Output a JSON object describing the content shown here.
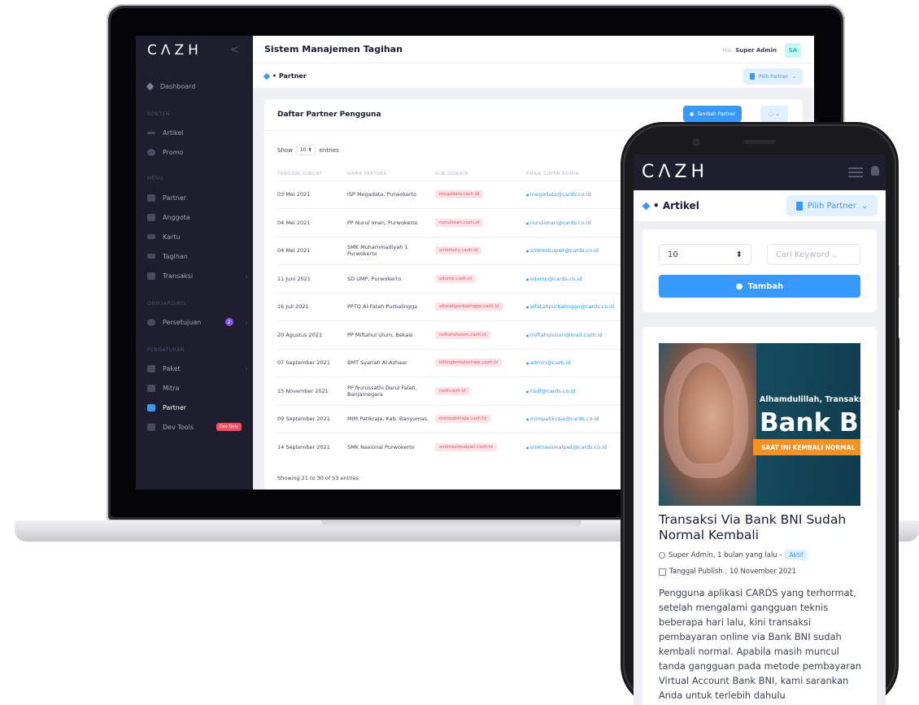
{
  "laptop": {
    "brand": "CΛZH",
    "collapse": "<",
    "sidebar": {
      "dashboard": "Dashboard",
      "section_konten": "KONTEN",
      "artikel": "Artikel",
      "promo": "Promo",
      "section_menu": "MENU",
      "partner": "Partner",
      "anggota": "Anggota",
      "kartu": "Kartu",
      "tagihan": "Tagihan",
      "transaksi": "Transaksi",
      "section_onboarding": "ONBOARDING",
      "persetujuan": "Persetujuan",
      "persetujuan_count": "2",
      "section_pengaturan": "PENGATURAN",
      "paket": "Paket",
      "mitra": "Mitra",
      "partner_active": "Partner",
      "devtools": "Dev Tools",
      "dev_badge": "Dev Only"
    },
    "header": {
      "title": "Sistem Manajemen Tagihan",
      "hello": "Hai,",
      "user": "Super Admin",
      "avatar": "SA"
    },
    "subheader": {
      "crumb": "• Partner",
      "pick_partner": "Pilih Partner"
    },
    "card": {
      "title": "Daftar Partner Pengguna",
      "add_button": "Tambah Partner",
      "show_label": "Show",
      "show_value": "10",
      "entries_label": "entries",
      "columns": [
        "TANGGAL DIBUAT",
        "NAMA PARTNER",
        "SUB DOMAIN",
        "EMAIL SUPER ADMIN"
      ],
      "rows": [
        {
          "date": "03 Mei 2021",
          "name": "ISP Megadata, Purwokerto",
          "sub": "megadata.cazh.id",
          "email": "megadata@cards.co.id"
        },
        {
          "date": "04 Mei 2021",
          "name": "PP Nurul Iman, Purwokerto",
          "sub": "nuruliman.cazh.id",
          "email": "nuruliman@cards.co.id"
        },
        {
          "date": "04 Mei 2021",
          "name": "SMK Muhammadiyah 1 Purwokerto",
          "sub": "smkmutu.cazh.id",
          "email": "smkmutupwt@cards.co.id"
        },
        {
          "date": "11 Juni 2021",
          "name": "SD UMP, Purwokerto",
          "sub": "sdump.cazh.id",
          "email": "sdump@cards.co.id"
        },
        {
          "date": "16 Juli 2021",
          "name": "PPTQ Al-Fatah Purbalingga",
          "sub": "alfatahpurbalingga.cazh.id",
          "email": "alfatahpurbalinggo@cards.co.id"
        },
        {
          "date": "20 Agustus 2021",
          "name": "PP Miftahul Ulum, Bekasi",
          "sub": "miftahululum.cazh.id",
          "email": "miftahululum@mail.cazh.id"
        },
        {
          "date": "07 September 2021",
          "name": "BMT Syariah Al-Azhaar",
          "sub": "billingbmtalazhaar.cazh.id",
          "email": "admin@cazh.id"
        },
        {
          "date": "15 November 2021",
          "name": "PP Nurussathi Darul Falah, Banjarnegara",
          "sub": "nsdf.cazh.id",
          "email": "nsdf@cards.co.id"
        },
        {
          "date": "09 September 2021",
          "name": "MIM Patikraja, Kab. Banyumas",
          "sub": "mimpatikraja.cazh.id",
          "email": "mimpatikraja@cards.co.id"
        },
        {
          "date": "14 September 2021",
          "name": "SMK Nasional Purwokerto",
          "sub": "smknasionalpwt.cazh.id",
          "email": "smknasionalpwt@cards.co.id"
        }
      ],
      "footnote": "Showing 21 to 30 of 53 entries"
    }
  },
  "phone": {
    "brand": "CΛZH",
    "crumb": "• Artikel",
    "pick_partner": "Pilih Partner",
    "select_value": "10",
    "search_placeholder": "Cari Keyword ..",
    "add_button": "Tambah",
    "banner": {
      "line1": "Alhamdulillah, Transaksi",
      "line2": "Bank BN",
      "line3": "SAAT INI KEMBALI NORMAL"
    },
    "article_title": "Transaksi Via Bank BNI Sudah Normal Kembali",
    "meta_author": "Super Admin, 1 bulan yang lalu -",
    "status": "Aktif",
    "publish": "Tanggal Publish : 10 November 2021",
    "body": "Pengguna aplikasi CARDS yang terhormat, setelah mengalami gangguan teknis beberapa hari lalu, kini transaksi pembayaran online via Bank BNI sudah kembali normal. Apabila masih muncul tanda gangguan pada metode pembayaran Virtual Account Bank BNI, kami sarankan Anda untuk terlebih dahulu"
  },
  "colors": {
    "primary": "#3699ff",
    "sidebar": "#1e1e2d",
    "danger": "#f64e60",
    "accent_orange": "#f39222"
  }
}
